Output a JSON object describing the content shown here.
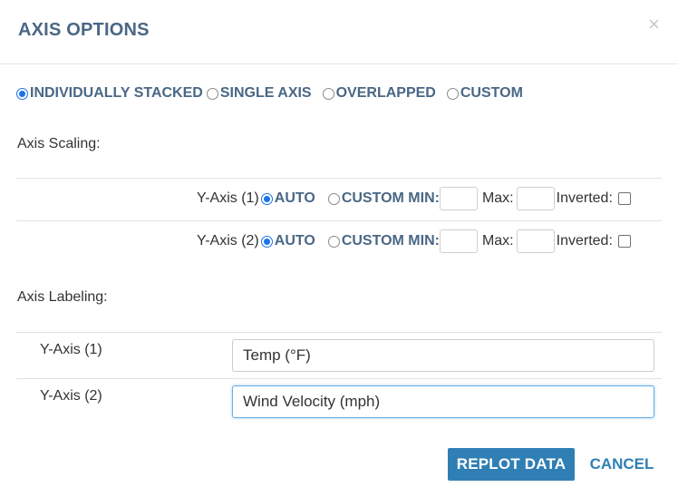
{
  "dialog": {
    "title": "AXIS OPTIONS",
    "close_symbol": "×"
  },
  "layout_modes": [
    {
      "label": "INDIVIDUALLY STACKED",
      "selected": true
    },
    {
      "label": "SINGLE AXIS",
      "selected": false
    },
    {
      "label": "OVERLAPPED",
      "selected": false
    },
    {
      "label": "CUSTOM",
      "selected": false
    }
  ],
  "axis_scaling": {
    "heading": "Axis Scaling:",
    "rows": [
      {
        "axis": "Y-Axis (1)",
        "auto_label": "AUTO",
        "custom_label": "CUSTOM MIN:",
        "max_label": "Max:",
        "inverted_label": "Inverted:",
        "mode": "auto",
        "min": "",
        "max": "",
        "inverted": false
      },
      {
        "axis": "Y-Axis (2)",
        "auto_label": "AUTO",
        "custom_label": "CUSTOM MIN:",
        "max_label": "Max:",
        "inverted_label": "Inverted:",
        "mode": "auto",
        "min": "",
        "max": "",
        "inverted": false
      }
    ]
  },
  "axis_labeling": {
    "heading": "Axis Labeling:",
    "rows": [
      {
        "axis": "Y-Axis (1)",
        "value": "Temp (°F)"
      },
      {
        "axis": "Y-Axis (2)",
        "value": "Wind Velocity (mph)"
      }
    ]
  },
  "actions": {
    "replot_label": "REPLOT DATA",
    "cancel_label": "CANCEL"
  },
  "colors": {
    "accent": "#1a73e8",
    "title": "#4a6785",
    "button": "#2f7fb5"
  }
}
